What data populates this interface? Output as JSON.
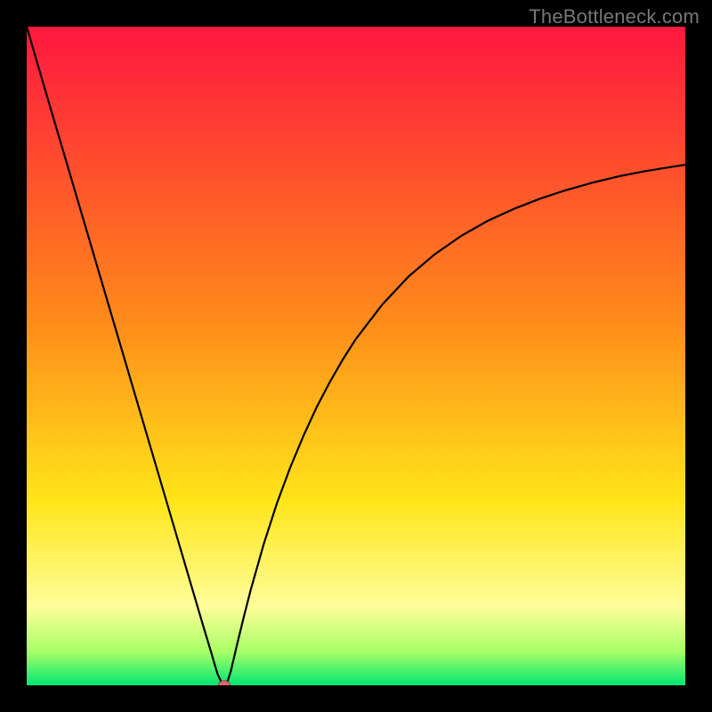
{
  "watermark": {
    "text": "TheBottleneck.com"
  },
  "chart_data": {
    "type": "line",
    "title": "",
    "xlabel": "",
    "ylabel": "",
    "xlim": [
      0,
      100
    ],
    "ylim": [
      0,
      115
    ],
    "x": [
      0,
      2,
      4,
      6,
      8,
      10,
      12,
      14,
      16,
      18,
      20,
      22,
      24,
      26,
      27,
      28,
      28.5,
      29,
      29.5,
      30,
      30.5,
      31,
      32,
      33,
      34,
      36,
      38,
      40,
      42,
      44,
      46,
      48,
      50,
      54,
      58,
      62,
      66,
      70,
      74,
      78,
      82,
      86,
      90,
      94,
      100
    ],
    "values": [
      115,
      107.1,
      99.3,
      91.5,
      83.7,
      75.9,
      68.1,
      60.3,
      52.5,
      44.7,
      36.9,
      29.1,
      21.3,
      13.5,
      9.6,
      5.8,
      3.8,
      1.9,
      0.7,
      0.1,
      0.7,
      2.5,
      7.4,
      12.1,
      16.6,
      24.7,
      31.8,
      38.0,
      43.5,
      48.5,
      52.9,
      56.9,
      60.5,
      66.5,
      71.4,
      75.3,
      78.5,
      81.1,
      83.2,
      85.0,
      86.5,
      87.8,
      88.9,
      89.8,
      90.9
    ],
    "marker": {
      "x": 30,
      "y": 0.1
    },
    "gradient": {
      "top": "#ff173f",
      "orange": "#ff8c1a",
      "yellow": "#ffe519",
      "pale": "#fffd9a",
      "lime": "#a6ff66",
      "green": "#00e673"
    },
    "curve_color": "#000000",
    "marker_fill": "#d56a71",
    "marker_stroke": "#a03d44"
  }
}
